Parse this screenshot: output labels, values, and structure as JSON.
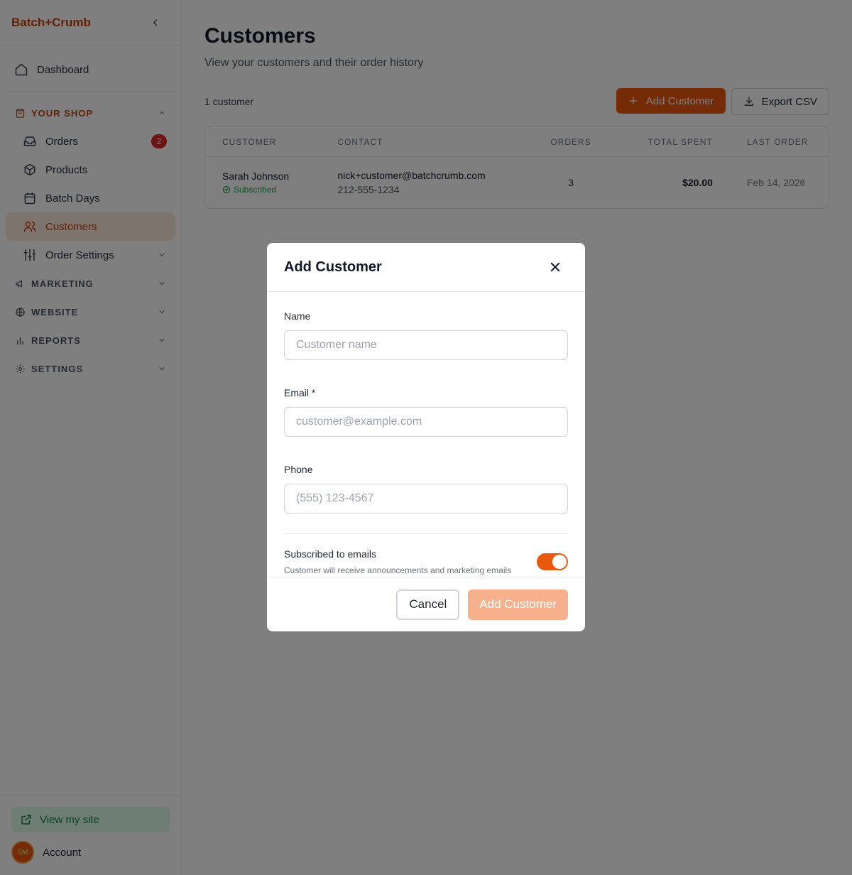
{
  "app": {
    "brand": "Batch+Crumb"
  },
  "sidebar": {
    "dashboard": "Dashboard",
    "your_shop": {
      "label": "YOUR SHOP",
      "items": [
        {
          "label": "Orders",
          "badge": "2",
          "icon": "inbox-icon"
        },
        {
          "label": "Products",
          "icon": "box-icon"
        },
        {
          "label": "Batch Days",
          "icon": "calendar-icon"
        },
        {
          "label": "Customers",
          "icon": "users-icon",
          "active": true
        },
        {
          "label": "Order Settings",
          "icon": "sliders-icon"
        }
      ]
    },
    "sections": [
      {
        "label": "MARKETING",
        "icon": "megaphone-icon"
      },
      {
        "label": "WEBSITE",
        "icon": "globe-icon"
      },
      {
        "label": "REPORTS",
        "icon": "bar-chart-icon"
      },
      {
        "label": "SETTINGS",
        "icon": "gear-icon"
      }
    ],
    "view_site": "View my site",
    "account": "Account",
    "avatar_initials": "SM"
  },
  "main": {
    "title": "Customers",
    "subtitle": "View your customers and their order history",
    "count": "1 customer",
    "add_button": "Add Customer",
    "export_button": "Export CSV",
    "table": {
      "headers": [
        "CUSTOMER",
        "CONTACT",
        "ORDERS",
        "TOTAL SPENT",
        "LAST ORDER"
      ],
      "rows": [
        {
          "name": "Sarah Johnson",
          "status": "Subscribed",
          "email": "nick+customer@batchcrumb.com",
          "phone": "212-555-1234",
          "orders": "3",
          "total": "$20.00",
          "last_order": "Feb 14, 2026"
        }
      ]
    }
  },
  "modal": {
    "title": "Add Customer",
    "name_label": "Name",
    "name_placeholder": "Customer name",
    "email_label": "Email *",
    "email_placeholder": "customer@example.com",
    "phone_label": "Phone",
    "phone_placeholder": "(555) 123-4567",
    "subscribe_label": "Subscribed to emails",
    "subscribe_desc": "Customer will receive announcements and marketing emails",
    "subscribe_on": true,
    "cancel": "Cancel",
    "submit": "Add Customer"
  },
  "colors": {
    "accent": "#ea580c",
    "brand": "#c2410c",
    "success": "#16a34a",
    "badge": "#dc2626"
  }
}
